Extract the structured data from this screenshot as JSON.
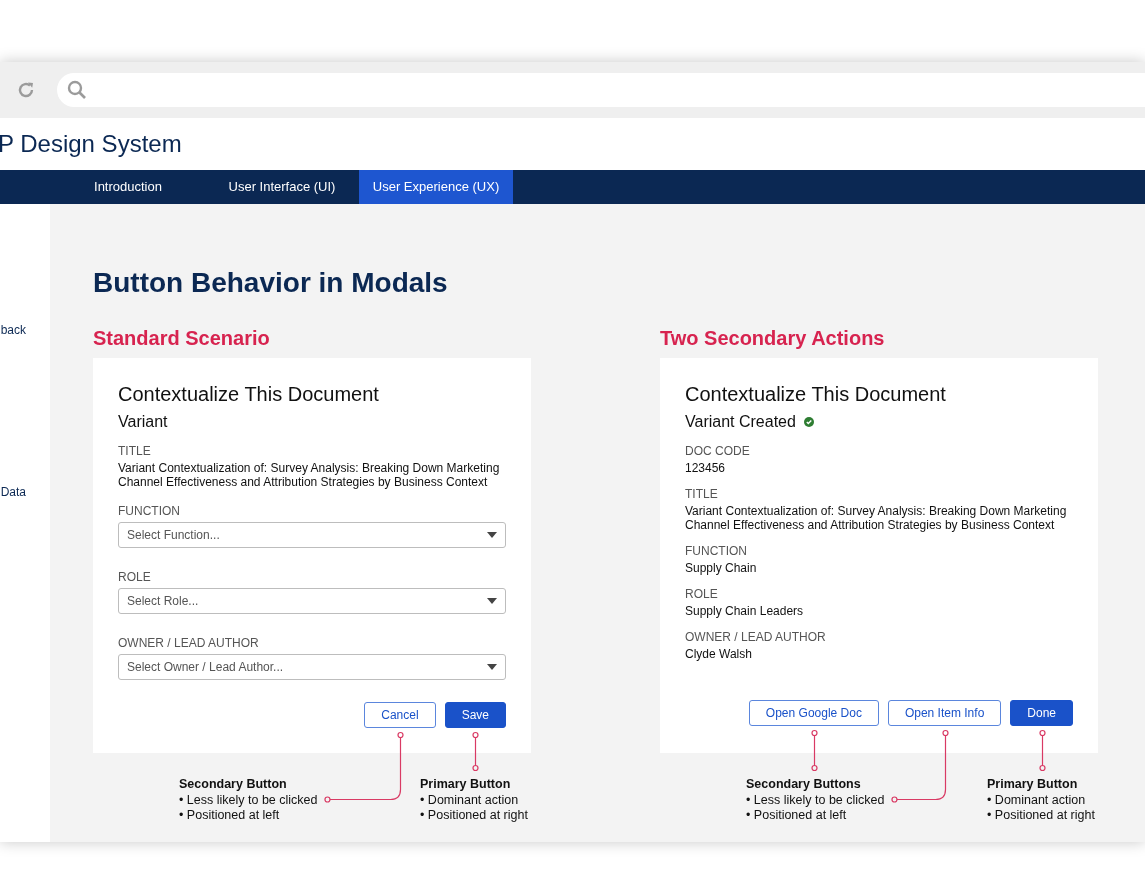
{
  "header": {
    "title": "P Design System"
  },
  "nav": {
    "tabs": [
      {
        "label": "Introduction",
        "selected": false
      },
      {
        "label": "User Interface (UI)",
        "selected": false
      },
      {
        "label": "User Experience (UX)",
        "selected": true
      }
    ]
  },
  "sidebar": {
    "items": [
      "back",
      "Data"
    ]
  },
  "page": {
    "heading": "Button Behavior in Modals"
  },
  "scenarios": [
    {
      "heading": "Standard Scenario",
      "modal": {
        "title": "Contextualize This Document",
        "subtitle": "Variant",
        "subtitle_check": false,
        "fields": [
          {
            "kind": "text",
            "label": "TITLE",
            "value": "Variant Contextualization of: Survey Analysis: Breaking Down Marketing Channel Effectiveness and Attribution Strategies by Business Context"
          },
          {
            "kind": "select",
            "label": "FUNCTION",
            "placeholder": "Select Function..."
          },
          {
            "kind": "select",
            "label": "ROLE",
            "placeholder": "Select Role..."
          },
          {
            "kind": "select",
            "label": "OWNER / LEAD AUTHOR",
            "placeholder": "Select Owner / Lead Author..."
          }
        ],
        "buttons": [
          {
            "label": "Cancel",
            "kind": "secondary"
          },
          {
            "label": "Save",
            "kind": "primary"
          }
        ]
      },
      "annotations": [
        {
          "title": "Secondary Button",
          "bullets": [
            "• Less likely to be clicked",
            "• Positioned at left"
          ],
          "kind": "secondary"
        },
        {
          "title": "Primary Button",
          "bullets": [
            "• Dominant action",
            "• Positioned at right"
          ],
          "kind": "primary"
        }
      ]
    },
    {
      "heading": "Two Secondary Actions",
      "modal": {
        "title": "Contextualize This Document",
        "subtitle": "Variant Created",
        "subtitle_check": true,
        "fields": [
          {
            "kind": "text",
            "label": "DOC CODE",
            "value": "123456"
          },
          {
            "kind": "text",
            "label": "TITLE",
            "value": "Variant Contextualization of: Survey Analysis: Breaking Down Marketing Channel Effectiveness and Attribution Strategies by Business Context"
          },
          {
            "kind": "text",
            "label": "FUNCTION",
            "value": "Supply Chain"
          },
          {
            "kind": "text",
            "label": "ROLE",
            "value": "Supply Chain Leaders"
          },
          {
            "kind": "text",
            "label": "OWNER / LEAD AUTHOR",
            "value": "Clyde Walsh"
          }
        ],
        "buttons": [
          {
            "label": "Open Google Doc",
            "kind": "secondary"
          },
          {
            "label": "Open Item Info",
            "kind": "secondary"
          },
          {
            "label": "Done",
            "kind": "primary"
          }
        ]
      },
      "annotations": [
        {
          "title": "Secondary Buttons",
          "bullets": [
            "• Less likely to be clicked",
            "• Positioned at left"
          ],
          "kind": "secondary"
        },
        {
          "title": "Primary Button",
          "bullets": [
            "• Dominant action",
            "• Positioned at right"
          ],
          "kind": "primary"
        }
      ]
    }
  ]
}
